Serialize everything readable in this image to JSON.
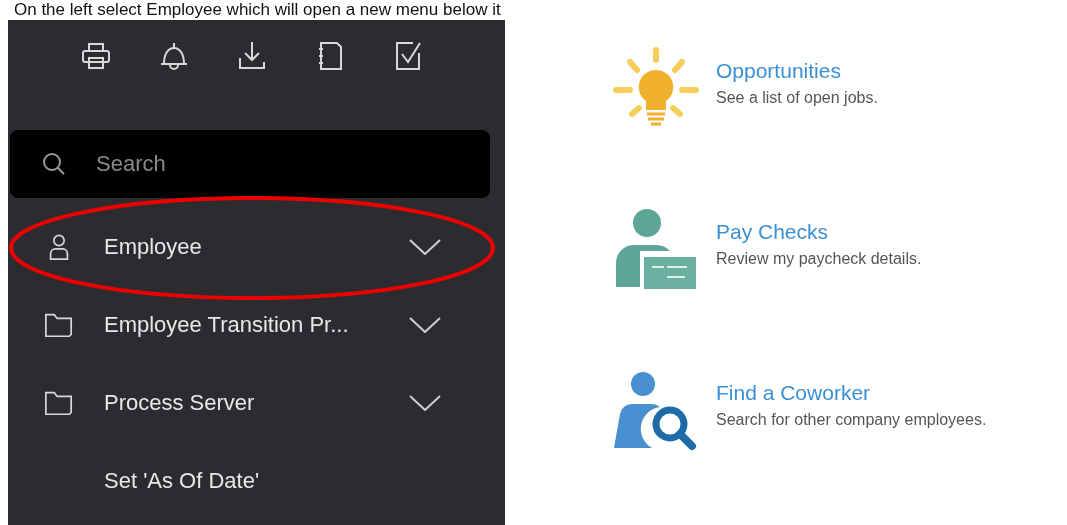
{
  "caption": "On the left select Employee which will open a new menu below it",
  "sidebar": {
    "search": {
      "placeholder": "Search"
    },
    "items": [
      {
        "label": "Employee",
        "kind": "user"
      },
      {
        "label": "Employee Transition Pr...",
        "kind": "folder"
      },
      {
        "label": "Process Server",
        "kind": "folder"
      },
      {
        "label": "Set 'As Of Date'",
        "kind": "action"
      }
    ]
  },
  "tiles": [
    {
      "kind": "idea",
      "title": "Opportunities",
      "description": "See a list of open jobs."
    },
    {
      "kind": "paycheck",
      "title": "Pay Checks",
      "description": "Review my paycheck details."
    },
    {
      "kind": "coworker",
      "title": "Find a Coworker",
      "description": "Search for other company employees."
    }
  ]
}
